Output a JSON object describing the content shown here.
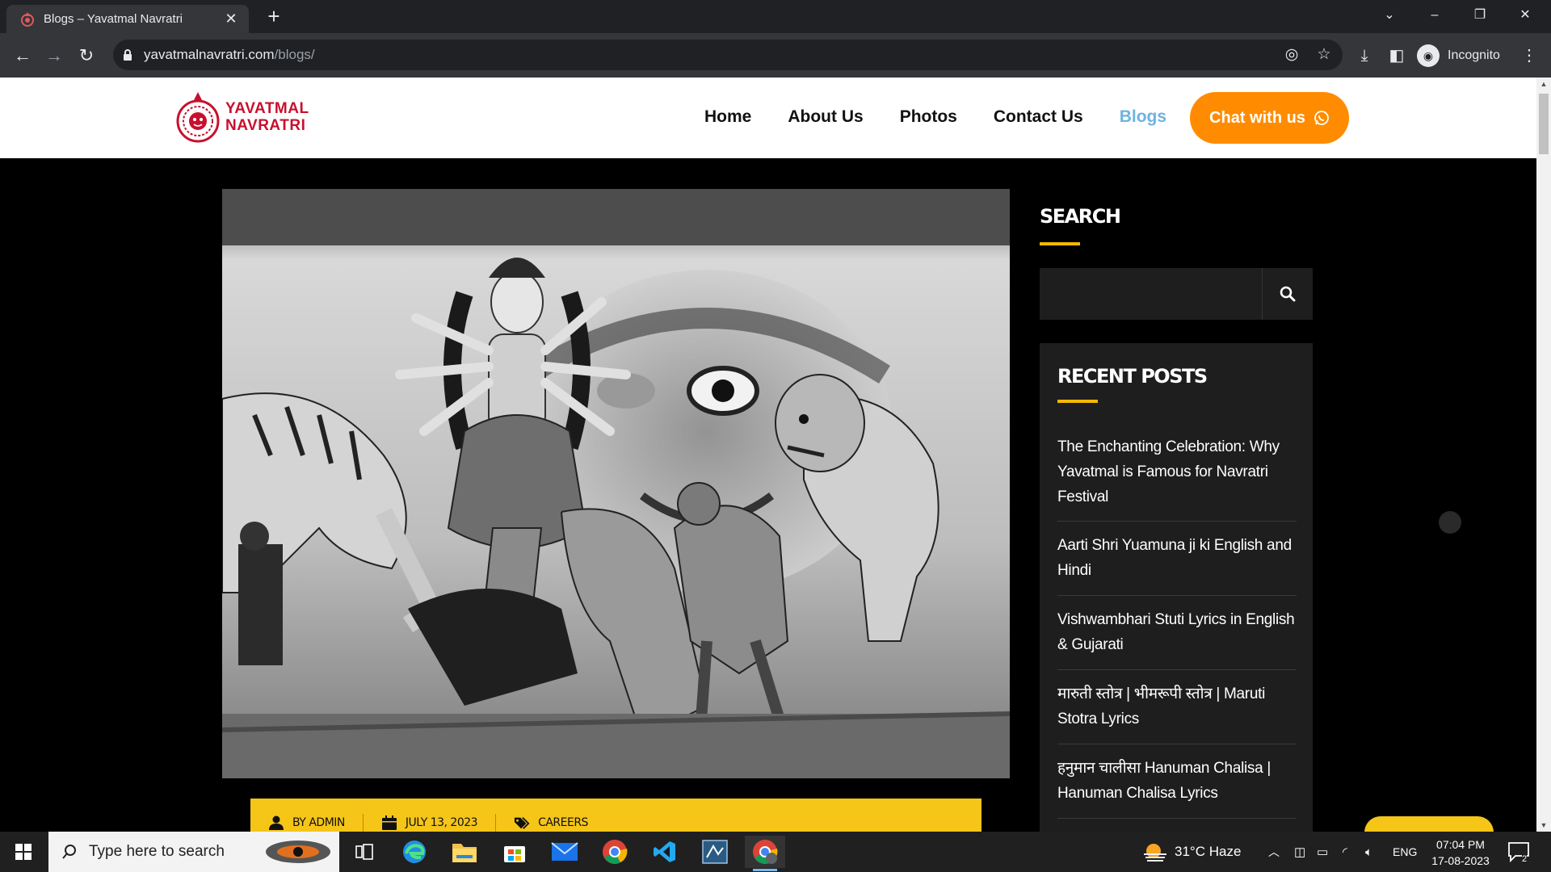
{
  "browser": {
    "tab_title": "Blogs – Yavatmal Navratri",
    "url_host": "yavatmalnavratri.com",
    "url_path": "/blogs/",
    "profile_label": "Incognito"
  },
  "site": {
    "logo_line1": "YAVATMAL",
    "logo_line2": "NAVRATRI",
    "nav": [
      "Home",
      "About Us",
      "Photos",
      "Contact Us",
      "Blogs"
    ],
    "active_nav": "Blogs",
    "chat_label": "Chat with us",
    "brand_color": "#c8102e",
    "accent_orange": "#ff8c00",
    "accent_yellow": "#f5c518"
  },
  "post": {
    "author": "BY ADMIN",
    "date": "JULY 13, 2023",
    "category": "CAREERS"
  },
  "sidebar": {
    "search_title": "SEARCH",
    "search_placeholder": "",
    "recent_title": "RECENT POSTS",
    "recent_posts": [
      "The Enchanting Celebration: Why Yavatmal is Famous for Navratri Festival",
      "Aarti Shri Yuamuna ji ki English and Hindi",
      "Vishwambhari Stuti Lyrics in English & Gujarati",
      "मारुती स्तोत्र | भीमरूपी स्तोत्र | Maruti Stotra Lyrics",
      "हनुमान चालीसा Hanuman Chalisa | Hanuman Chalisa Lyrics"
    ]
  },
  "taskbar": {
    "search_placeholder": "Type here to search",
    "weather": "31°C  Haze",
    "language": "ENG",
    "time": "07:04 PM",
    "date": "17-08-2023",
    "notifications": "2"
  }
}
